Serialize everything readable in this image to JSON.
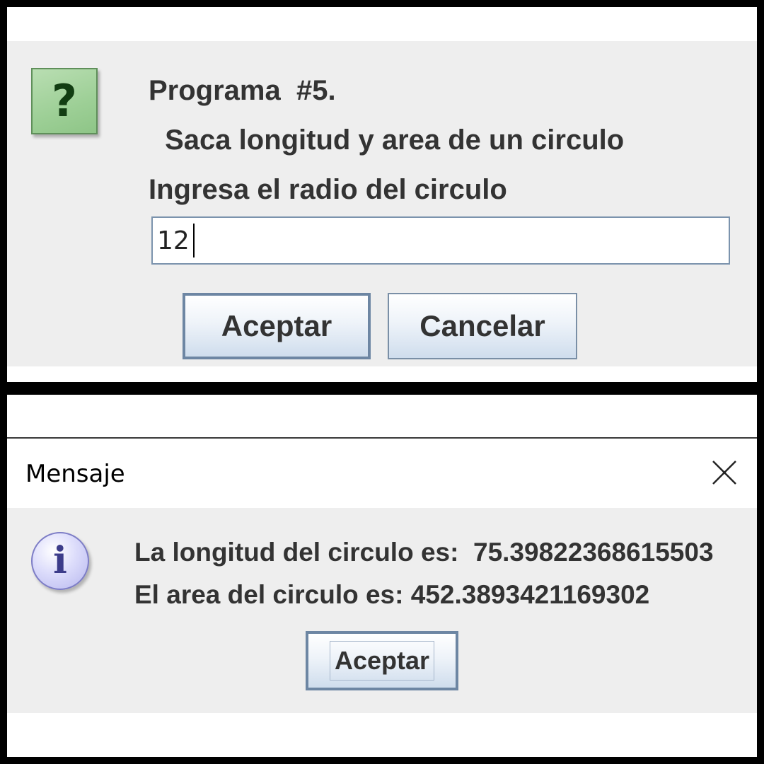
{
  "input_dialog": {
    "icon": "question-icon",
    "icon_color": "#9dcf96",
    "message_lines": [
      "Programa  #5.",
      " Saca longitud y area de un circulo",
      "Ingresa el radio del circulo"
    ],
    "input_value": "12",
    "buttons": {
      "ok_label": "Aceptar",
      "cancel_label": "Cancelar"
    }
  },
  "message_dialog": {
    "title": "Mensaje",
    "close_icon": "close-icon",
    "icon": "info-icon",
    "icon_color": "#b7b7ee",
    "lines": [
      "La longitud del circulo es:  75.39822368615503",
      "El area del circulo es: 452.3893421169302"
    ],
    "ok_label": "Aceptar"
  }
}
